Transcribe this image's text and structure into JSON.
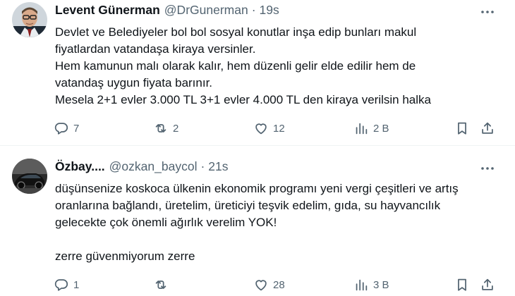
{
  "tweets": [
    {
      "author_name": "Levent Günerman",
      "handle": "@DrGunerman",
      "separator": "·",
      "time": "19s",
      "avatar": "photo-man-glasses",
      "text_lines": [
        "Devlet ve Belediyeler bol bol sosyal konutlar inşa edip bunları makul",
        "fiyatlardan vatandaşa kiraya versinler.",
        "Hem kamunun malı olarak kalır, hem düzenli gelir elde edilir hem de",
        "vatandaş uygun fiyata barınır.",
        "Mesela 2+1 evler 3.000 TL 3+1 evler 4.000 TL den kiraya verilsin halka"
      ],
      "replies": "7",
      "retweets": "2",
      "likes": "12",
      "views": "2 B"
    },
    {
      "author_name": "Özbay....",
      "handle": "@ozkan_baycol",
      "separator": "·",
      "time": "21s",
      "avatar": "photo-dark-car",
      "text_lines": [
        "düşünsenize koskoca ülkenin ekonomik programı yeni vergi çeşitleri ve artış",
        "oranlarına bağlandı, üretelim, üreticiyi teşvik edelim, gıda, su hayvancılık",
        "gelecekte çok önemli ağırlık verelim YOK!",
        "",
        "zerre güvenmiyorum zerre"
      ],
      "replies": "1",
      "retweets": "",
      "likes": "28",
      "views": "3 B"
    }
  ],
  "icons": {
    "reply": "reply-icon",
    "retweet": "retweet-icon",
    "like": "heart-icon",
    "views": "views-icon",
    "bookmark": "bookmark-icon",
    "share": "share-icon",
    "more": "more-icon"
  },
  "colors": {
    "text": "#0f1419",
    "secondary": "#536471",
    "divider": "#eff3f4"
  }
}
